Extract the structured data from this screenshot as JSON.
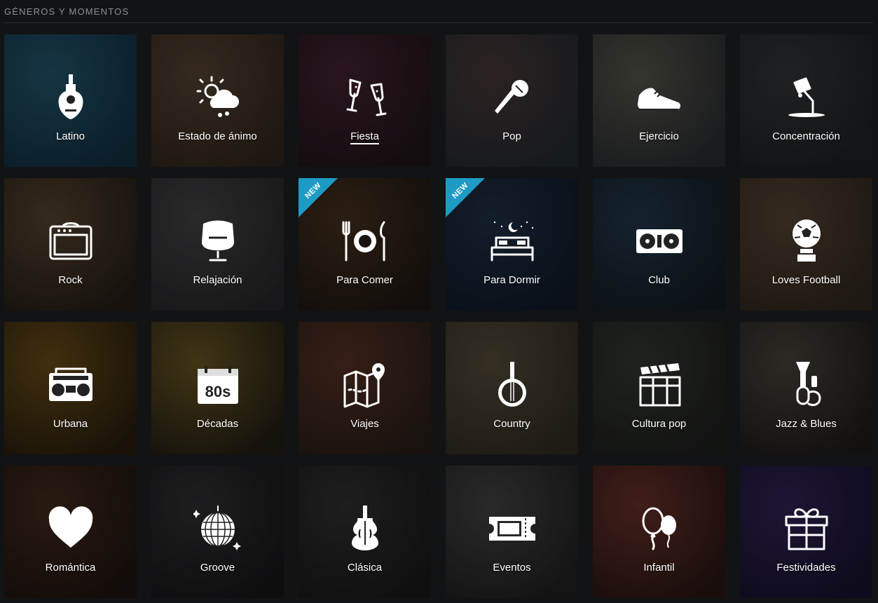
{
  "header": {
    "title": "GÉNEROS Y MOMENTOS"
  },
  "tiles": [
    {
      "label": "Latino",
      "icon": "guitar-icon",
      "bg": "#1f4a5e",
      "bg2": "#0e2a38"
    },
    {
      "label": "Estado de ánimo",
      "icon": "weather-icon",
      "bg": "#4a3a2c",
      "bg2": "#2a2018"
    },
    {
      "label": "Fiesta",
      "icon": "champagne-icon",
      "bg": "#3a1e2a",
      "bg2": "#1b1216"
    },
    {
      "label": "Pop",
      "icon": "microphone-icon",
      "bg": "#3e3030",
      "bg2": "#1e2428"
    },
    {
      "label": "Ejercicio",
      "icon": "sneaker-icon",
      "bg": "#4a4a40",
      "bg2": "#24262a"
    },
    {
      "label": "Concentración",
      "icon": "desk-lamp-icon",
      "bg": "#2c2e30",
      "bg2": "#1a1c1e"
    },
    {
      "label": "Rock",
      "icon": "amplifier-icon",
      "bg": "#4a3a28",
      "bg2": "#201a14"
    },
    {
      "label": "Relajación",
      "icon": "armchair-icon",
      "bg": "#3a3a3c",
      "bg2": "#222224"
    },
    {
      "label": "Para Comer",
      "icon": "plate-cutlery-icon",
      "bg": "#3c2a1a",
      "bg2": "#1a1410",
      "badge": "NEW"
    },
    {
      "label": "Para Dormir",
      "icon": "bed-moon-icon",
      "bg": "#1a2a3c",
      "bg2": "#0e1622",
      "badge": "NEW"
    },
    {
      "label": "Club",
      "icon": "turntables-icon",
      "bg": "#1e3040",
      "bg2": "#10181e"
    },
    {
      "label": "Loves Football",
      "icon": "football-trophy-icon",
      "bg": "#4a3a2c",
      "bg2": "#2a221a"
    },
    {
      "label": "Urbana",
      "icon": "boombox-icon",
      "bg": "#5a4214",
      "bg2": "#241a0c"
    },
    {
      "label": "Décadas",
      "icon": "calendar-80s-icon",
      "bg": "#5a4a1e",
      "bg2": "#1e1a12"
    },
    {
      "label": "Viajes",
      "icon": "map-pin-icon",
      "bg": "#4a2a1e",
      "bg2": "#241a16"
    },
    {
      "label": "Country",
      "icon": "banjo-icon",
      "bg": "#4a4232",
      "bg2": "#2a261e"
    },
    {
      "label": "Cultura pop",
      "icon": "clapperboard-icon",
      "bg": "#2c302a",
      "bg2": "#1a1c1a"
    },
    {
      "label": "Jazz & Blues",
      "icon": "trumpet-icon",
      "bg": "#3e3a34",
      "bg2": "#1a1816"
    },
    {
      "label": "Romántica",
      "icon": "heart-icon",
      "bg": "#3a2418",
      "bg2": "#1a120e"
    },
    {
      "label": "Groove",
      "icon": "disco-ball-icon",
      "bg": "#2a2a2c",
      "bg2": "#141416"
    },
    {
      "label": "Clásica",
      "icon": "violin-icon",
      "bg": "#2a2a2a",
      "bg2": "#161616"
    },
    {
      "label": "Eventos",
      "icon": "ticket-icon",
      "bg": "#3a3a3a",
      "bg2": "#1c1c1c"
    },
    {
      "label": "Infantil",
      "icon": "balloons-icon",
      "bg": "#5a2a24",
      "bg2": "#241412"
    },
    {
      "label": "Festividades",
      "icon": "gift-icon",
      "bg": "#2a1e4a",
      "bg2": "#141028"
    }
  ]
}
